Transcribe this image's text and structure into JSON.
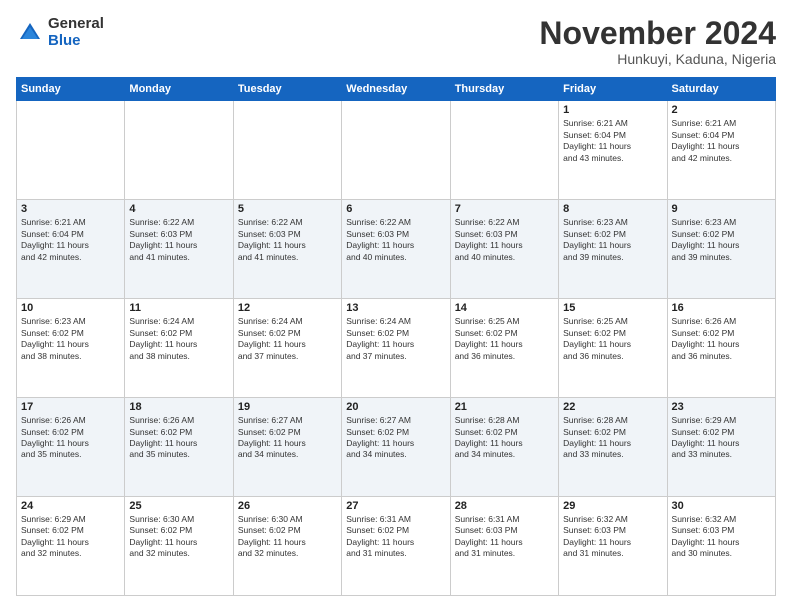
{
  "logo": {
    "general": "General",
    "blue": "Blue"
  },
  "title": "November 2024",
  "location": "Hunkuyi, Kaduna, Nigeria",
  "days_header": [
    "Sunday",
    "Monday",
    "Tuesday",
    "Wednesday",
    "Thursday",
    "Friday",
    "Saturday"
  ],
  "weeks": [
    [
      {
        "day": "",
        "info": ""
      },
      {
        "day": "",
        "info": ""
      },
      {
        "day": "",
        "info": ""
      },
      {
        "day": "",
        "info": ""
      },
      {
        "day": "",
        "info": ""
      },
      {
        "day": "1",
        "info": "Sunrise: 6:21 AM\nSunset: 6:04 PM\nDaylight: 11 hours\nand 43 minutes."
      },
      {
        "day": "2",
        "info": "Sunrise: 6:21 AM\nSunset: 6:04 PM\nDaylight: 11 hours\nand 42 minutes."
      }
    ],
    [
      {
        "day": "3",
        "info": "Sunrise: 6:21 AM\nSunset: 6:04 PM\nDaylight: 11 hours\nand 42 minutes."
      },
      {
        "day": "4",
        "info": "Sunrise: 6:22 AM\nSunset: 6:03 PM\nDaylight: 11 hours\nand 41 minutes."
      },
      {
        "day": "5",
        "info": "Sunrise: 6:22 AM\nSunset: 6:03 PM\nDaylight: 11 hours\nand 41 minutes."
      },
      {
        "day": "6",
        "info": "Sunrise: 6:22 AM\nSunset: 6:03 PM\nDaylight: 11 hours\nand 40 minutes."
      },
      {
        "day": "7",
        "info": "Sunrise: 6:22 AM\nSunset: 6:03 PM\nDaylight: 11 hours\nand 40 minutes."
      },
      {
        "day": "8",
        "info": "Sunrise: 6:23 AM\nSunset: 6:02 PM\nDaylight: 11 hours\nand 39 minutes."
      },
      {
        "day": "9",
        "info": "Sunrise: 6:23 AM\nSunset: 6:02 PM\nDaylight: 11 hours\nand 39 minutes."
      }
    ],
    [
      {
        "day": "10",
        "info": "Sunrise: 6:23 AM\nSunset: 6:02 PM\nDaylight: 11 hours\nand 38 minutes."
      },
      {
        "day": "11",
        "info": "Sunrise: 6:24 AM\nSunset: 6:02 PM\nDaylight: 11 hours\nand 38 minutes."
      },
      {
        "day": "12",
        "info": "Sunrise: 6:24 AM\nSunset: 6:02 PM\nDaylight: 11 hours\nand 37 minutes."
      },
      {
        "day": "13",
        "info": "Sunrise: 6:24 AM\nSunset: 6:02 PM\nDaylight: 11 hours\nand 37 minutes."
      },
      {
        "day": "14",
        "info": "Sunrise: 6:25 AM\nSunset: 6:02 PM\nDaylight: 11 hours\nand 36 minutes."
      },
      {
        "day": "15",
        "info": "Sunrise: 6:25 AM\nSunset: 6:02 PM\nDaylight: 11 hours\nand 36 minutes."
      },
      {
        "day": "16",
        "info": "Sunrise: 6:26 AM\nSunset: 6:02 PM\nDaylight: 11 hours\nand 36 minutes."
      }
    ],
    [
      {
        "day": "17",
        "info": "Sunrise: 6:26 AM\nSunset: 6:02 PM\nDaylight: 11 hours\nand 35 minutes."
      },
      {
        "day": "18",
        "info": "Sunrise: 6:26 AM\nSunset: 6:02 PM\nDaylight: 11 hours\nand 35 minutes."
      },
      {
        "day": "19",
        "info": "Sunrise: 6:27 AM\nSunset: 6:02 PM\nDaylight: 11 hours\nand 34 minutes."
      },
      {
        "day": "20",
        "info": "Sunrise: 6:27 AM\nSunset: 6:02 PM\nDaylight: 11 hours\nand 34 minutes."
      },
      {
        "day": "21",
        "info": "Sunrise: 6:28 AM\nSunset: 6:02 PM\nDaylight: 11 hours\nand 34 minutes."
      },
      {
        "day": "22",
        "info": "Sunrise: 6:28 AM\nSunset: 6:02 PM\nDaylight: 11 hours\nand 33 minutes."
      },
      {
        "day": "23",
        "info": "Sunrise: 6:29 AM\nSunset: 6:02 PM\nDaylight: 11 hours\nand 33 minutes."
      }
    ],
    [
      {
        "day": "24",
        "info": "Sunrise: 6:29 AM\nSunset: 6:02 PM\nDaylight: 11 hours\nand 32 minutes."
      },
      {
        "day": "25",
        "info": "Sunrise: 6:30 AM\nSunset: 6:02 PM\nDaylight: 11 hours\nand 32 minutes."
      },
      {
        "day": "26",
        "info": "Sunrise: 6:30 AM\nSunset: 6:02 PM\nDaylight: 11 hours\nand 32 minutes."
      },
      {
        "day": "27",
        "info": "Sunrise: 6:31 AM\nSunset: 6:02 PM\nDaylight: 11 hours\nand 31 minutes."
      },
      {
        "day": "28",
        "info": "Sunrise: 6:31 AM\nSunset: 6:03 PM\nDaylight: 11 hours\nand 31 minutes."
      },
      {
        "day": "29",
        "info": "Sunrise: 6:32 AM\nSunset: 6:03 PM\nDaylight: 11 hours\nand 31 minutes."
      },
      {
        "day": "30",
        "info": "Sunrise: 6:32 AM\nSunset: 6:03 PM\nDaylight: 11 hours\nand 30 minutes."
      }
    ]
  ]
}
